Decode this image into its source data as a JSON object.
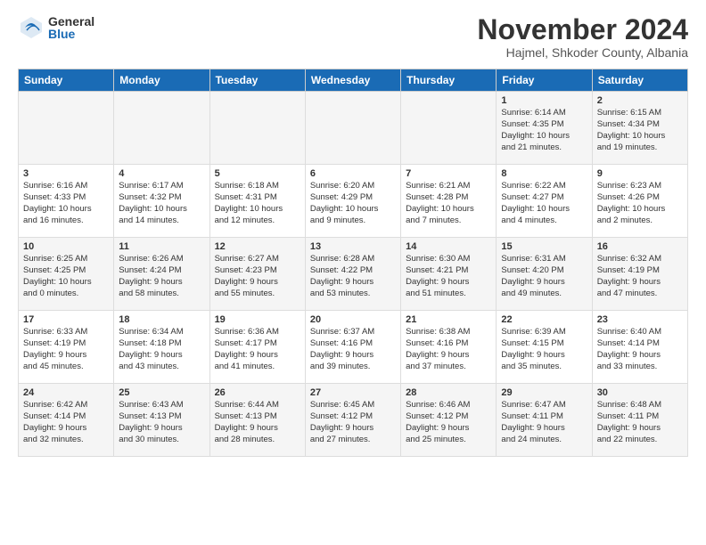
{
  "header": {
    "logo_general": "General",
    "logo_blue": "Blue",
    "month_title": "November 2024",
    "location": "Hajmel, Shkoder County, Albania"
  },
  "weekdays": [
    "Sunday",
    "Monday",
    "Tuesday",
    "Wednesday",
    "Thursday",
    "Friday",
    "Saturday"
  ],
  "weeks": [
    [
      {
        "day": "",
        "info": ""
      },
      {
        "day": "",
        "info": ""
      },
      {
        "day": "",
        "info": ""
      },
      {
        "day": "",
        "info": ""
      },
      {
        "day": "",
        "info": ""
      },
      {
        "day": "1",
        "info": "Sunrise: 6:14 AM\nSunset: 4:35 PM\nDaylight: 10 hours\nand 21 minutes."
      },
      {
        "day": "2",
        "info": "Sunrise: 6:15 AM\nSunset: 4:34 PM\nDaylight: 10 hours\nand 19 minutes."
      }
    ],
    [
      {
        "day": "3",
        "info": "Sunrise: 6:16 AM\nSunset: 4:33 PM\nDaylight: 10 hours\nand 16 minutes."
      },
      {
        "day": "4",
        "info": "Sunrise: 6:17 AM\nSunset: 4:32 PM\nDaylight: 10 hours\nand 14 minutes."
      },
      {
        "day": "5",
        "info": "Sunrise: 6:18 AM\nSunset: 4:31 PM\nDaylight: 10 hours\nand 12 minutes."
      },
      {
        "day": "6",
        "info": "Sunrise: 6:20 AM\nSunset: 4:29 PM\nDaylight: 10 hours\nand 9 minutes."
      },
      {
        "day": "7",
        "info": "Sunrise: 6:21 AM\nSunset: 4:28 PM\nDaylight: 10 hours\nand 7 minutes."
      },
      {
        "day": "8",
        "info": "Sunrise: 6:22 AM\nSunset: 4:27 PM\nDaylight: 10 hours\nand 4 minutes."
      },
      {
        "day": "9",
        "info": "Sunrise: 6:23 AM\nSunset: 4:26 PM\nDaylight: 10 hours\nand 2 minutes."
      }
    ],
    [
      {
        "day": "10",
        "info": "Sunrise: 6:25 AM\nSunset: 4:25 PM\nDaylight: 10 hours\nand 0 minutes."
      },
      {
        "day": "11",
        "info": "Sunrise: 6:26 AM\nSunset: 4:24 PM\nDaylight: 9 hours\nand 58 minutes."
      },
      {
        "day": "12",
        "info": "Sunrise: 6:27 AM\nSunset: 4:23 PM\nDaylight: 9 hours\nand 55 minutes."
      },
      {
        "day": "13",
        "info": "Sunrise: 6:28 AM\nSunset: 4:22 PM\nDaylight: 9 hours\nand 53 minutes."
      },
      {
        "day": "14",
        "info": "Sunrise: 6:30 AM\nSunset: 4:21 PM\nDaylight: 9 hours\nand 51 minutes."
      },
      {
        "day": "15",
        "info": "Sunrise: 6:31 AM\nSunset: 4:20 PM\nDaylight: 9 hours\nand 49 minutes."
      },
      {
        "day": "16",
        "info": "Sunrise: 6:32 AM\nSunset: 4:19 PM\nDaylight: 9 hours\nand 47 minutes."
      }
    ],
    [
      {
        "day": "17",
        "info": "Sunrise: 6:33 AM\nSunset: 4:19 PM\nDaylight: 9 hours\nand 45 minutes."
      },
      {
        "day": "18",
        "info": "Sunrise: 6:34 AM\nSunset: 4:18 PM\nDaylight: 9 hours\nand 43 minutes."
      },
      {
        "day": "19",
        "info": "Sunrise: 6:36 AM\nSunset: 4:17 PM\nDaylight: 9 hours\nand 41 minutes."
      },
      {
        "day": "20",
        "info": "Sunrise: 6:37 AM\nSunset: 4:16 PM\nDaylight: 9 hours\nand 39 minutes."
      },
      {
        "day": "21",
        "info": "Sunrise: 6:38 AM\nSunset: 4:16 PM\nDaylight: 9 hours\nand 37 minutes."
      },
      {
        "day": "22",
        "info": "Sunrise: 6:39 AM\nSunset: 4:15 PM\nDaylight: 9 hours\nand 35 minutes."
      },
      {
        "day": "23",
        "info": "Sunrise: 6:40 AM\nSunset: 4:14 PM\nDaylight: 9 hours\nand 33 minutes."
      }
    ],
    [
      {
        "day": "24",
        "info": "Sunrise: 6:42 AM\nSunset: 4:14 PM\nDaylight: 9 hours\nand 32 minutes."
      },
      {
        "day": "25",
        "info": "Sunrise: 6:43 AM\nSunset: 4:13 PM\nDaylight: 9 hours\nand 30 minutes."
      },
      {
        "day": "26",
        "info": "Sunrise: 6:44 AM\nSunset: 4:13 PM\nDaylight: 9 hours\nand 28 minutes."
      },
      {
        "day": "27",
        "info": "Sunrise: 6:45 AM\nSunset: 4:12 PM\nDaylight: 9 hours\nand 27 minutes."
      },
      {
        "day": "28",
        "info": "Sunrise: 6:46 AM\nSunset: 4:12 PM\nDaylight: 9 hours\nand 25 minutes."
      },
      {
        "day": "29",
        "info": "Sunrise: 6:47 AM\nSunset: 4:11 PM\nDaylight: 9 hours\nand 24 minutes."
      },
      {
        "day": "30",
        "info": "Sunrise: 6:48 AM\nSunset: 4:11 PM\nDaylight: 9 hours\nand 22 minutes."
      }
    ]
  ]
}
